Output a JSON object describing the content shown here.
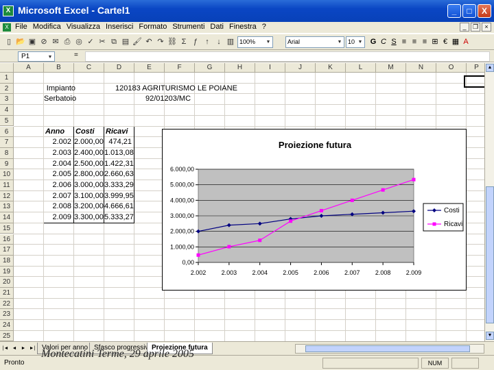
{
  "window": {
    "title": "Microsoft Excel - Cartel1",
    "app_icon": "X",
    "min": "_",
    "max": "□",
    "close": "X"
  },
  "menu": {
    "doc_icon": "X",
    "items": [
      "File",
      "Modifica",
      "Visualizza",
      "Inserisci",
      "Formato",
      "Strumenti",
      "Dati",
      "Finestra",
      "?"
    ]
  },
  "toolbar": {
    "icons": [
      "new-icon",
      "open-icon",
      "save-icon",
      "permission-icon",
      "mail-icon",
      "print-icon",
      "preview-icon",
      "spelling-icon",
      "cut-icon",
      "copy-icon",
      "paste-icon",
      "format-painter-icon",
      "undo-icon",
      "redo-icon",
      "hyperlink-icon",
      "autosum-icon",
      "function-icon",
      "sort-asc-icon",
      "sort-desc-icon",
      "chart-wizard-icon",
      "drawing-icon"
    ],
    "zoom": "100%",
    "font": "Arial",
    "size": "10",
    "format_buttons": [
      "G",
      "C",
      "S"
    ],
    "currency": "€"
  },
  "formula_bar": {
    "name_box": "P1",
    "fx": "=",
    "value": ""
  },
  "columns": [
    "A",
    "B",
    "C",
    "D",
    "E",
    "F",
    "G",
    "H",
    "I",
    "J",
    "K",
    "L",
    "M",
    "N",
    "O",
    "P"
  ],
  "rows": [
    "1",
    "2",
    "3",
    "4",
    "5",
    "6",
    "7",
    "8",
    "9",
    "10",
    "11",
    "12",
    "13",
    "14",
    "15",
    "16",
    "17",
    "18",
    "19",
    "20",
    "21",
    "22",
    "23",
    "24",
    "25"
  ],
  "cells": {
    "impianto_label": "Impianto",
    "impianto_value": "120183 AGRITURISMO LE POIANE",
    "serbatoio_label": "Serbatoio",
    "serbatoio_value": "92/01203/MC",
    "headers": [
      "Anno",
      "Costi",
      "Ricavi"
    ],
    "table": [
      [
        "2.002",
        "2.000,00",
        "474,21"
      ],
      [
        "2.003",
        "2.400,00",
        "1.013,08"
      ],
      [
        "2.004",
        "2.500,00",
        "1.422,31"
      ],
      [
        "2.005",
        "2.800,00",
        "2.660,63"
      ],
      [
        "2.006",
        "3.000,00",
        "3.333,29"
      ],
      [
        "2.007",
        "3.100,00",
        "3.999,95"
      ],
      [
        "2.008",
        "3.200,00",
        "4.666,61"
      ],
      [
        "2.009",
        "3.300,00",
        "5.333,27"
      ]
    ]
  },
  "chart_data": {
    "type": "line",
    "title": "Proiezione futura",
    "categories": [
      "2.002",
      "2.003",
      "2.004",
      "2.005",
      "2.006",
      "2.007",
      "2.008",
      "2.009"
    ],
    "series": [
      {
        "name": "Costi",
        "values": [
          2000,
          2400,
          2500,
          2800,
          3000,
          3100,
          3200,
          3300
        ],
        "color": "#000080",
        "marker": "diamond"
      },
      {
        "name": "Ricavi",
        "values": [
          474.21,
          1013.08,
          1422.31,
          2660.63,
          3333.29,
          3999.95,
          4666.61,
          5333.27
        ],
        "color": "#ff00ff",
        "marker": "square"
      }
    ],
    "ylim": [
      0,
      6000
    ],
    "y_ticks": [
      "0,00",
      "1.000,00",
      "2.000,00",
      "3.000,00",
      "4.000,00",
      "5.000,00",
      "6.000,00"
    ],
    "plot_background": "#c0c0c0",
    "grid": true,
    "legend": "right"
  },
  "sheet_tabs": [
    "Valori per anno",
    "Sfasco progressivo",
    "Proiezione futura"
  ],
  "active_tab": "Proiezione futura",
  "status": {
    "left": "Pronto",
    "num": "NUM"
  },
  "caption": "Montecatini Terme, 29 aprile 2005"
}
